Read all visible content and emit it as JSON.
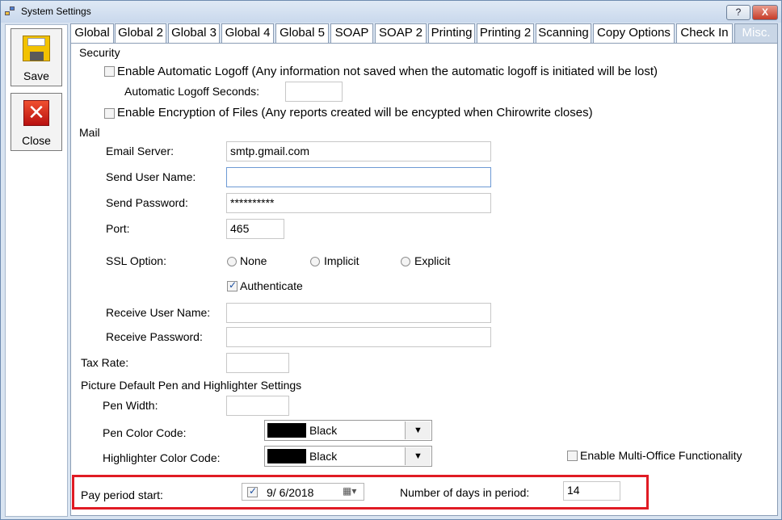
{
  "window": {
    "title": "System Settings",
    "help_label": "?",
    "close_label": "X"
  },
  "toolbar": {
    "save_label": "Save",
    "close_label": "Close"
  },
  "tabs": [
    "Global",
    "Global 2",
    "Global 3",
    "Global 4",
    "Global 5",
    "SOAP",
    "SOAP 2",
    "Printing",
    "Printing 2",
    "Scanning",
    "Copy Options",
    "Check In",
    "Misc."
  ],
  "active_tab": "Misc.",
  "security": {
    "heading": "Security",
    "auto_logoff_label": "Enable Automatic Logoff (Any information not saved when the automatic logoff is initiated will be lost)",
    "auto_logoff_checked": false,
    "logoff_seconds_label": "Automatic Logoff Seconds:",
    "logoff_seconds_value": "",
    "encryption_label": "Enable Encryption of Files (Any reports created will be encypted when Chirowrite closes)",
    "encryption_checked": false
  },
  "mail": {
    "heading": "Mail",
    "email_server_label": "Email Server:",
    "email_server_value": "smtp.gmail.com",
    "send_user_label": "Send User Name:",
    "send_user_value": "",
    "send_password_label": "Send Password:",
    "send_password_value": "**********",
    "port_label": "Port:",
    "port_value": "465",
    "ssl_label": "SSL Option:",
    "ssl_options": [
      "None",
      "Implicit",
      "Explicit"
    ],
    "authenticate_label": "Authenticate",
    "authenticate_checked": true,
    "receive_user_label": "Receive User Name:",
    "receive_user_value": "",
    "receive_password_label": "Receive Password:",
    "receive_password_value": ""
  },
  "tax": {
    "label": "Tax Rate:",
    "value": ""
  },
  "picture": {
    "heading": "Picture Default Pen and Highlighter Settings",
    "pen_width_label": "Pen Width:",
    "pen_width_value": "",
    "pen_color_label": "Pen Color Code:",
    "pen_color_value": "Black",
    "highlighter_color_label": "Highlighter Color Code:",
    "highlighter_color_value": "Black",
    "swatch_color": "#000000"
  },
  "multi_office": {
    "label": "Enable Multi-Office Functionality",
    "checked": false
  },
  "pay_period": {
    "start_label": "Pay period start:",
    "start_checked": true,
    "start_date": "9/  6/2018",
    "days_label": "Number of days in period:",
    "days_value": "14"
  },
  "colors": {
    "highlight_border": "#e01b24",
    "active_tab_bg": "#c9d6e6"
  }
}
